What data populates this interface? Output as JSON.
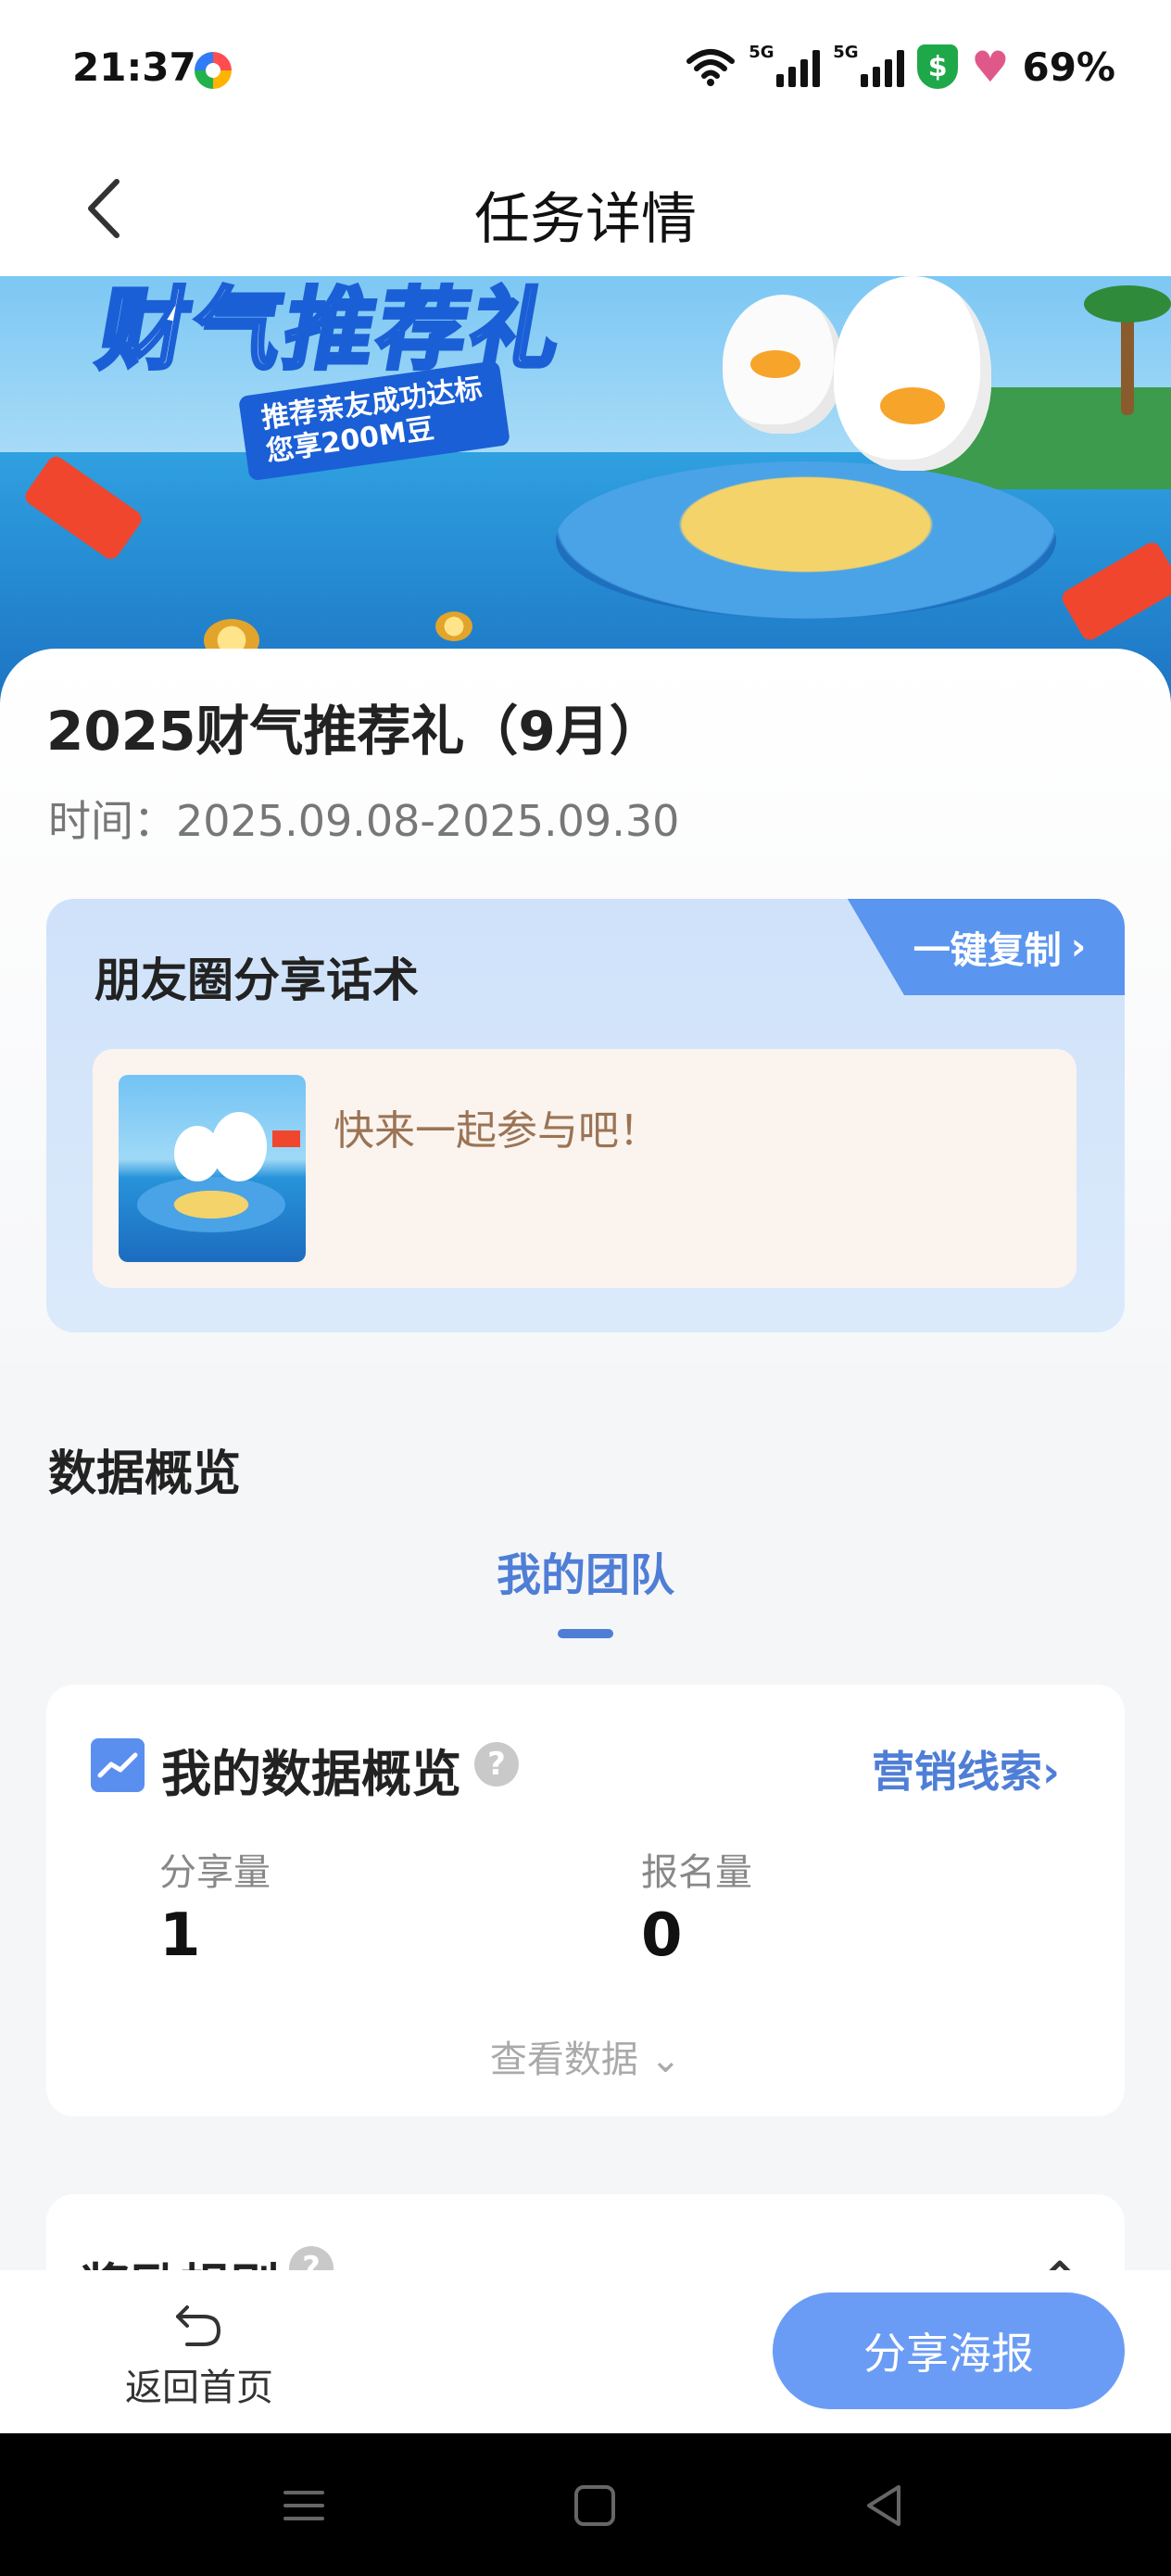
{
  "status_bar": {
    "time": "21:37",
    "signal_1_tag": "5G",
    "signal_2_tag": "5G",
    "shield_symbol": "$",
    "battery": "69%"
  },
  "nav": {
    "title": "任务详情",
    "back_icon": "chevron-left-icon"
  },
  "banner": {
    "slogan_big": "财气推荐礼",
    "slogan_line1": "推荐亲友成功达标",
    "slogan_line2": "您享200M豆"
  },
  "task": {
    "title": "2025财气推荐礼（9月）",
    "time": "时间：2025.09.08-2025.09.30"
  },
  "share_box": {
    "title": "朋友圈分享话术",
    "copy_label": "一键复制",
    "text": "快来一起参与吧！"
  },
  "overview": {
    "section_title": "数据概览",
    "tab_label": "我的团队",
    "card_title": "我的数据概览",
    "help_symbol": "?",
    "marketing_link": "营销线索",
    "stats": [
      {
        "label": "分享量",
        "value": "1"
      },
      {
        "label": "报名量",
        "value": "0"
      }
    ],
    "view_data": "查看数据"
  },
  "reward": {
    "title": "奖励规则"
  },
  "bottom_bar": {
    "home_label": "返回首页",
    "share_poster": "分享海报"
  },
  "colors": {
    "accent": "#4f7ed6",
    "button": "#6b9cf5",
    "share_box_bg": "#cfe2fa",
    "share_text": "#9a7455"
  }
}
